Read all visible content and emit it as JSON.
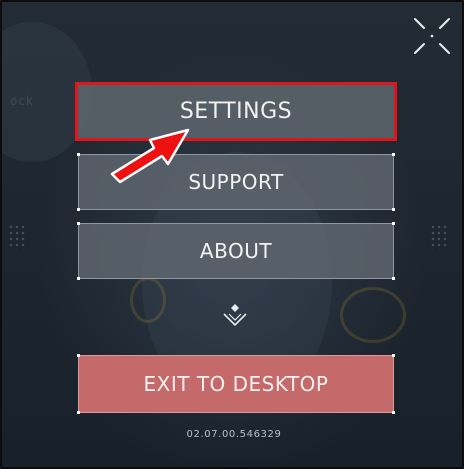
{
  "menu": {
    "settings_label": "SETTINGS",
    "support_label": "SUPPORT",
    "about_label": "ABOUT",
    "exit_label": "EXIT TO DESKTOP"
  },
  "footer": {
    "version": "02.07.00.546329"
  },
  "background": {
    "partial_text": "ock"
  },
  "icons": {
    "fullscreen": "fullscreen-icon",
    "annotation_arrow": "red-arrow-icon",
    "scroll_down": "chevron-down-icon"
  },
  "colors": {
    "highlight_border": "#e0141c",
    "exit_button": "#c46a6a",
    "button_gray": "#5c646c"
  }
}
